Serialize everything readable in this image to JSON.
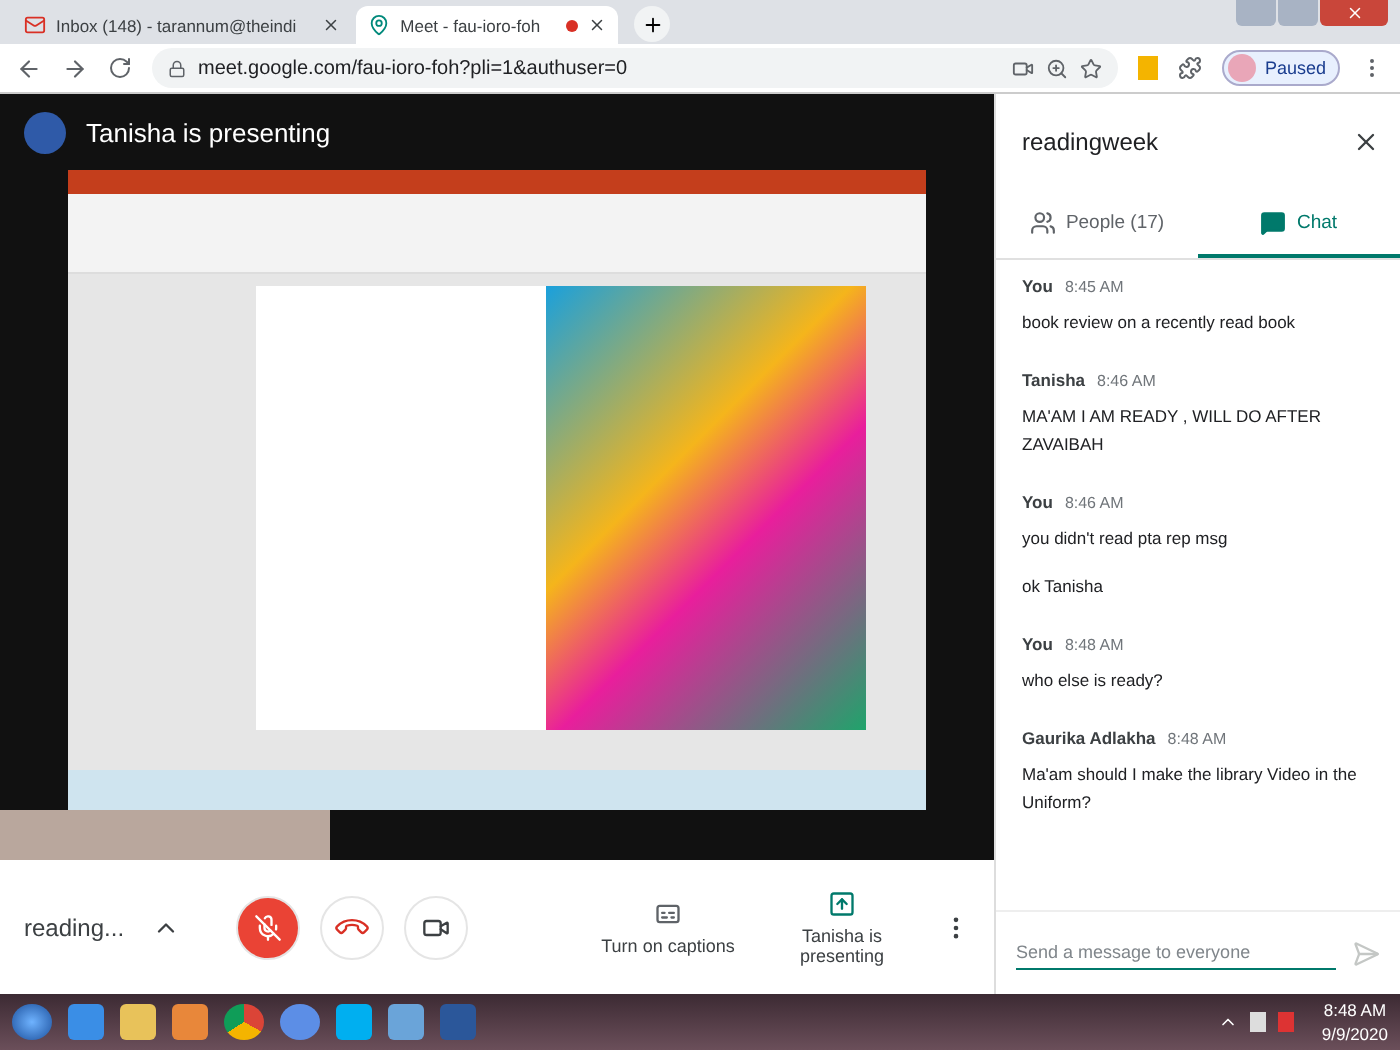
{
  "browser": {
    "tabs": [
      {
        "title": "Inbox (148) - tarannum@theindi",
        "selected": false,
        "kind": "mail"
      },
      {
        "title": "Meet - fau-ioro-foh",
        "selected": true,
        "kind": "meet"
      }
    ],
    "url": "meet.google.com/fau-ioro-foh?pli=1&authuser=0",
    "profile_label": "Paused"
  },
  "stage": {
    "presenter_banner": "Tanisha is presenting"
  },
  "controls": {
    "meeting_name": "reading...",
    "mic_muted": true,
    "captions_label": "Turn on captions",
    "presenting_label": "Tanisha is presenting"
  },
  "chat_panel": {
    "title": "readingweek",
    "tabs": [
      {
        "label": "People (17)",
        "selected": false,
        "kind": "people"
      },
      {
        "label": "Chat",
        "selected": true,
        "kind": "chat"
      }
    ],
    "messages": [
      {
        "sender": "You",
        "time": "8:45 AM",
        "texts": [
          "book review on a recently read book"
        ]
      },
      {
        "sender": "Tanisha",
        "time": "8:46 AM",
        "texts": [
          "MA'AM I AM READY , WILL DO AFTER ZAVAIBAH"
        ]
      },
      {
        "sender": "You",
        "time": "8:46 AM",
        "texts": [
          "you didn't read pta rep msg",
          "ok Tanisha"
        ]
      },
      {
        "sender": "You",
        "time": "8:48 AM",
        "texts": [
          "who else is ready?"
        ]
      },
      {
        "sender": "Gaurika Adlakha",
        "time": "8:48 AM",
        "texts": [
          "Ma'am should I make the library Video in the Uniform?"
        ]
      }
    ],
    "input": {
      "placeholder": "Send a message to everyone"
    }
  },
  "taskbar": {
    "time": "8:48 AM",
    "date": "9/9/2020"
  }
}
